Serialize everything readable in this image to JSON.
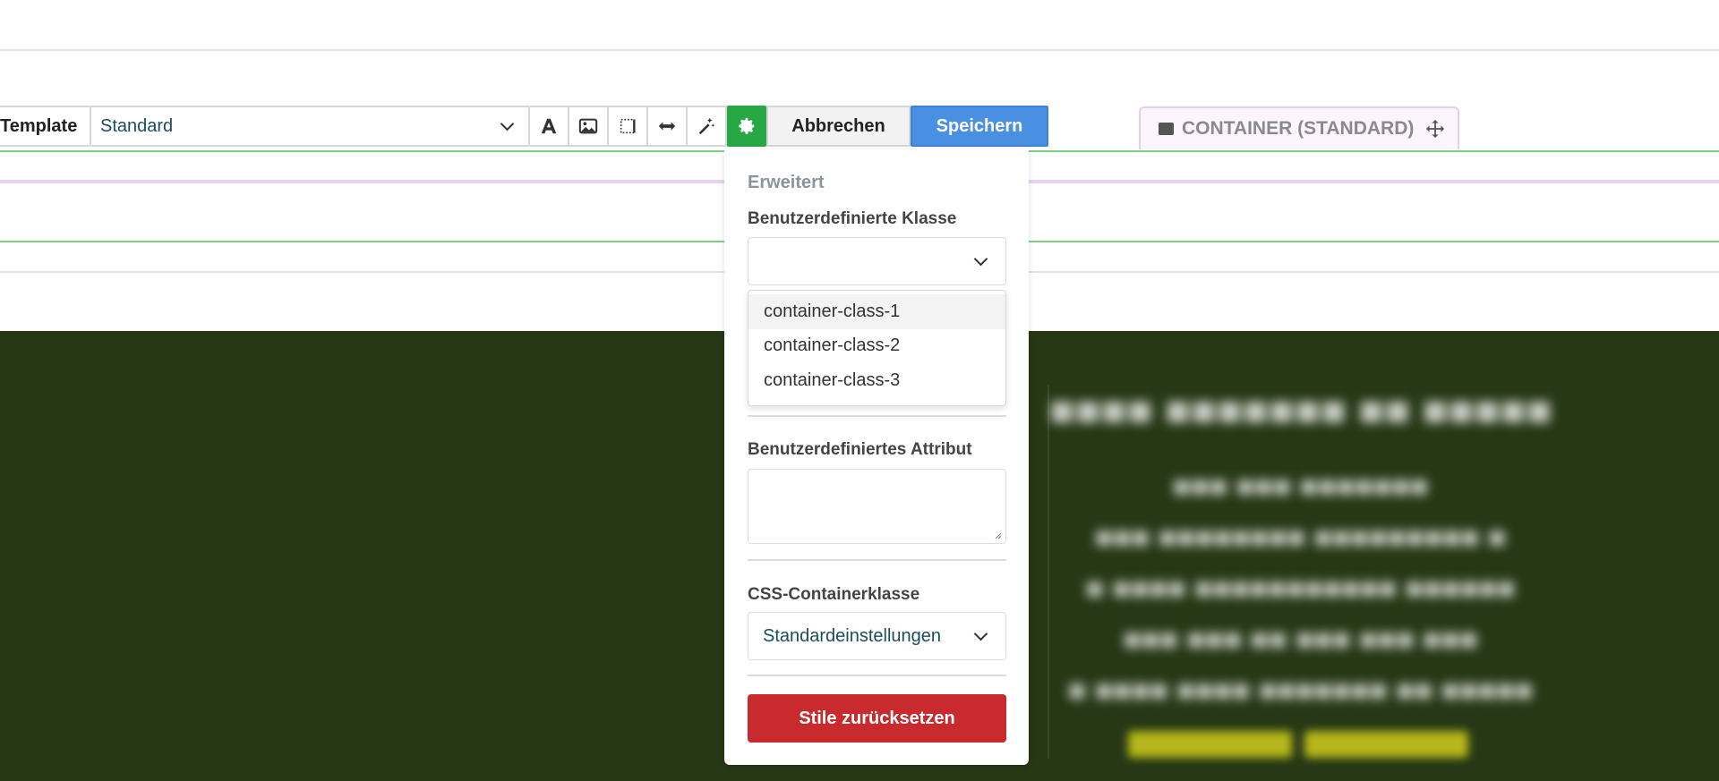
{
  "toolbar": {
    "template_label": "Template",
    "template_value": "Standard",
    "tools": [
      "text-format-icon",
      "image-icon",
      "spacing-icon",
      "width-icon",
      "magic-wand-icon"
    ],
    "settings_icon": "gear-icon",
    "cancel_label": "Abbrechen",
    "save_label": "Speichern"
  },
  "container_tab": {
    "label": "CONTAINER (STANDARD)",
    "icon": "move-icon"
  },
  "panel": {
    "section_title": "Erweitert",
    "custom_class_label": "Benutzerdefinierte Klasse",
    "custom_class_value": "",
    "custom_class_options": [
      "container-class-1",
      "container-class-2",
      "container-class-3"
    ],
    "custom_attribute_label": "Benutzerdefiniertes Attribut",
    "custom_attribute_value": "",
    "css_container_label": "CSS-Containerklasse",
    "css_container_value": "Standardeinstellungen",
    "reset_label": "Stile zurücksetzen"
  },
  "colors": {
    "accent_green": "#28a745",
    "save_blue": "#4a90e2",
    "reset_red": "#c82a2e",
    "footer_bg": "#263816"
  }
}
